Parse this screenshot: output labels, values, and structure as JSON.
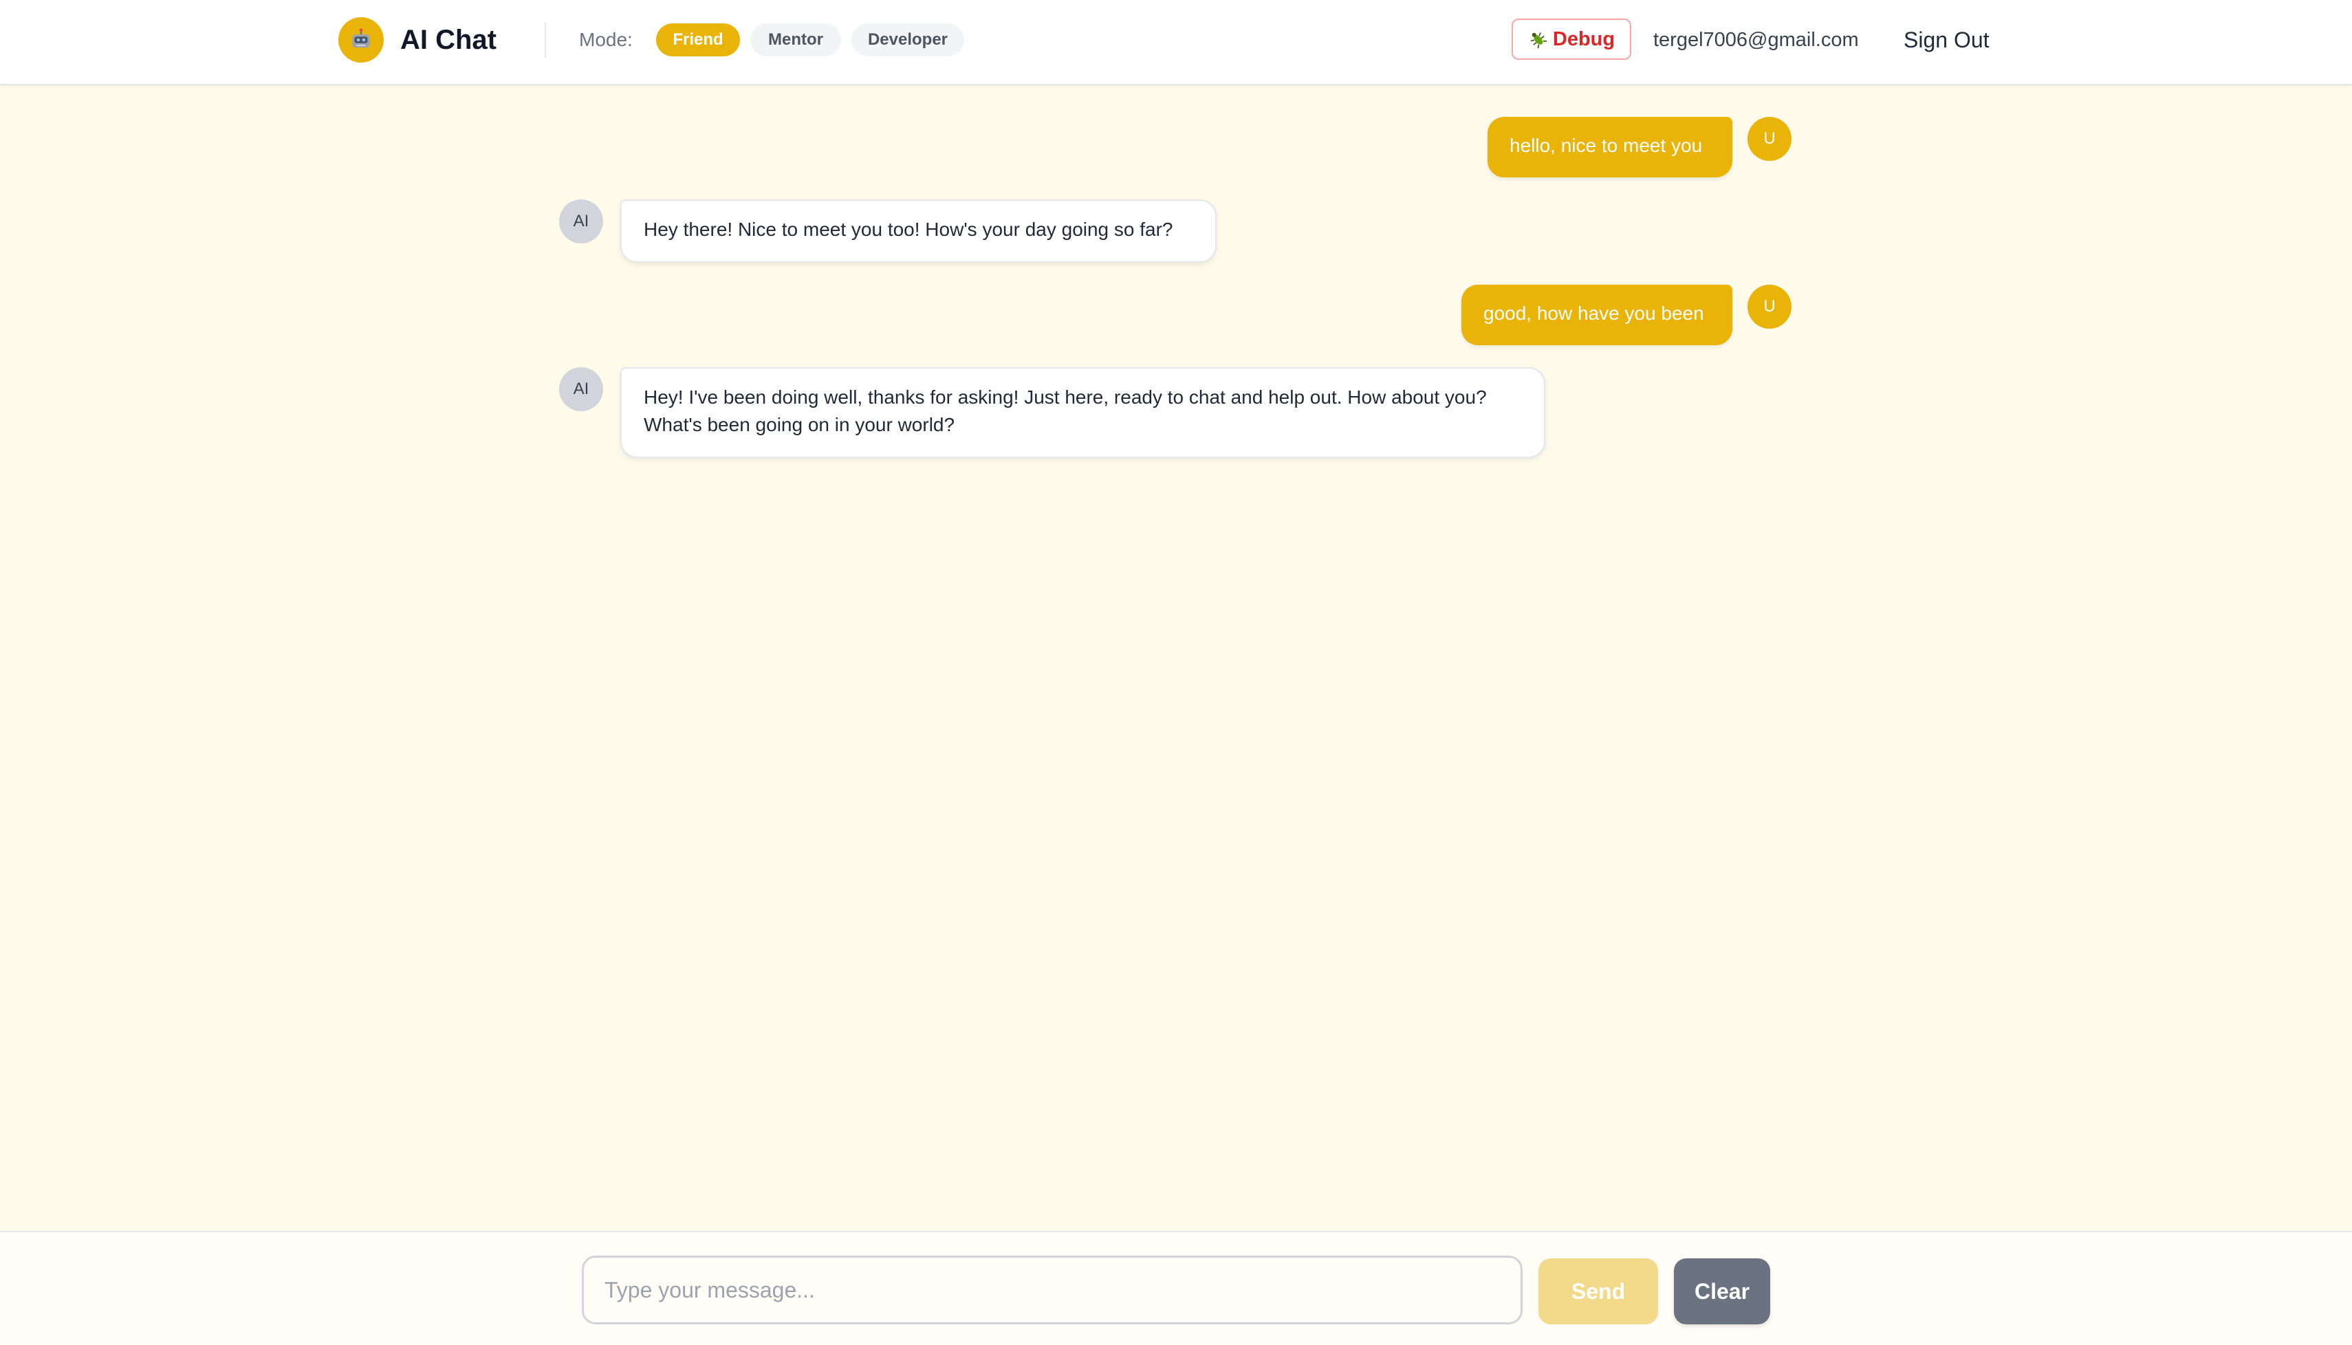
{
  "header": {
    "logo_icon": "robot-icon",
    "app_title": "AI Chat",
    "mode_label": "Mode:",
    "modes": [
      {
        "label": "Friend",
        "active": true
      },
      {
        "label": "Mentor",
        "active": false
      },
      {
        "label": "Developer",
        "active": false
      }
    ],
    "debug_icon": "bug-icon",
    "debug_label": "Debug",
    "user_email": "tergel7006@gmail.com",
    "sign_out_label": "Sign Out"
  },
  "chat": {
    "messages": [
      {
        "role": "user",
        "avatar": "U",
        "text": "hello, nice to meet you"
      },
      {
        "role": "ai",
        "avatar": "AI",
        "text": "Hey there! Nice to meet you too! How's your day going so far?"
      },
      {
        "role": "user",
        "avatar": "U",
        "text": "good, how have you been"
      },
      {
        "role": "ai",
        "avatar": "AI",
        "text": "Hey! I've been doing well, thanks for asking! Just here, ready to chat and help out. How about you? What's been going on in your world?"
      }
    ]
  },
  "composer": {
    "placeholder": "Type your message...",
    "value": "",
    "send_label": "Send",
    "clear_label": "Clear"
  },
  "colors": {
    "accent": "#eab308",
    "background": "#fefbeb",
    "debug": "#dc2626",
    "clear_button": "#6b7280"
  }
}
